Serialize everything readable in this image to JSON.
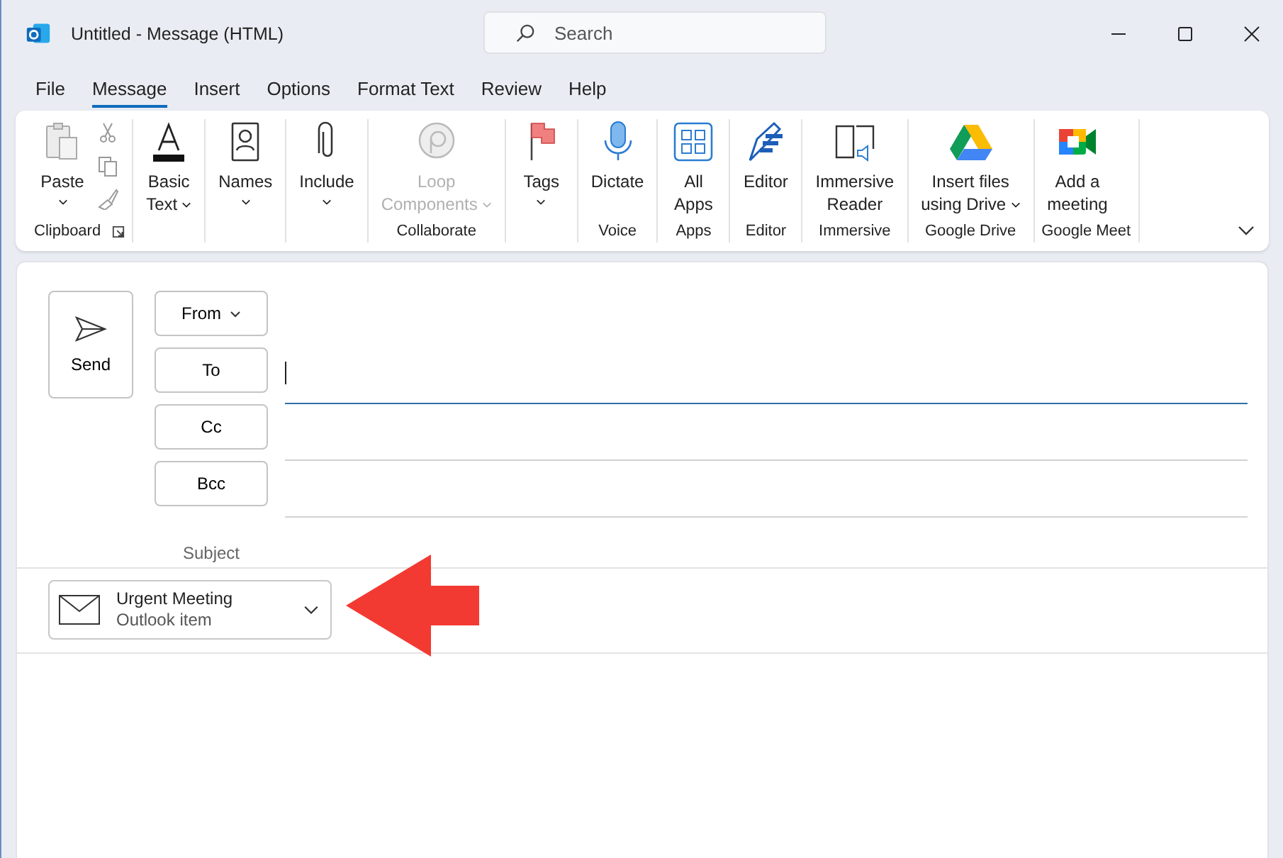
{
  "window": {
    "title": "Untitled  -  Message (HTML)"
  },
  "search": {
    "placeholder": "Search"
  },
  "tabs": [
    {
      "label": "File",
      "selected": false
    },
    {
      "label": "Message",
      "selected": true
    },
    {
      "label": "Insert",
      "selected": false
    },
    {
      "label": "Options",
      "selected": false
    },
    {
      "label": "Format Text",
      "selected": false
    },
    {
      "label": "Review",
      "selected": false
    },
    {
      "label": "Help",
      "selected": false
    }
  ],
  "ribbon": {
    "groups": [
      {
        "label": "Clipboard",
        "launcher": true,
        "tools": [
          {
            "kind": "cut"
          },
          {
            "kind": "copy"
          },
          {
            "kind": "painter"
          }
        ],
        "buttons": [
          {
            "kind": "paste",
            "lines": [
              "Paste"
            ],
            "dropdown": true,
            "disabled": false
          }
        ]
      },
      {
        "buttons": [
          {
            "kind": "text",
            "lines": [
              "Basic",
              "Text"
            ],
            "dropdown": true,
            "disabled": false
          }
        ]
      },
      {
        "buttons": [
          {
            "kind": "names",
            "lines": [
              "Names"
            ],
            "dropdown": true,
            "disabled": false
          }
        ]
      },
      {
        "buttons": [
          {
            "kind": "attach",
            "lines": [
              "Include"
            ],
            "dropdown": true,
            "disabled": false
          }
        ]
      },
      {
        "label": "Collaborate",
        "buttons": [
          {
            "kind": "loop",
            "lines": [
              "Loop",
              "Components"
            ],
            "dropdown": true,
            "disabled": true
          }
        ]
      },
      {
        "buttons": [
          {
            "kind": "flag",
            "lines": [
              "Tags"
            ],
            "dropdown": true,
            "disabled": false
          }
        ]
      },
      {
        "label": "Voice",
        "buttons": [
          {
            "kind": "mic",
            "lines": [
              "Dictate"
            ],
            "dropdown": false,
            "disabled": false
          }
        ]
      },
      {
        "label": "Apps",
        "buttons": [
          {
            "kind": "apps",
            "lines": [
              "All",
              "Apps"
            ],
            "dropdown": false,
            "disabled": false
          }
        ]
      },
      {
        "label": "Editor",
        "buttons": [
          {
            "kind": "editor",
            "lines": [
              "Editor"
            ],
            "dropdown": false,
            "disabled": false
          }
        ]
      },
      {
        "label": "Immersive",
        "buttons": [
          {
            "kind": "reader",
            "lines": [
              "Immersive",
              "Reader"
            ],
            "dropdown": false,
            "disabled": false
          }
        ]
      },
      {
        "label": "Google Drive",
        "buttons": [
          {
            "kind": "drive",
            "lines": [
              "Insert files",
              "using Drive"
            ],
            "dropdown": true,
            "disabled": false
          }
        ]
      },
      {
        "label": "Google Meet",
        "buttons": [
          {
            "kind": "meet",
            "lines": [
              "Add a",
              "meeting"
            ],
            "dropdown": false,
            "disabled": false
          }
        ]
      }
    ]
  },
  "compose": {
    "send_button": "Send",
    "from_button": {
      "label": "From"
    },
    "recipients": [
      {
        "label": "To",
        "focused": true
      },
      {
        "label": "Cc",
        "focused": false
      },
      {
        "label": "Bcc",
        "focused": false
      }
    ],
    "subject_label": "Subject",
    "attachment": {
      "name": "Urgent Meeting",
      "type": "Outlook item"
    }
  }
}
